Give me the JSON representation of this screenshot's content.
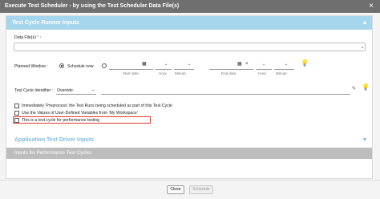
{
  "window": {
    "title": "Execute Test Scheduler - by using the Test Scheduler Data File(s)",
    "close_glyph": "×"
  },
  "runner_section": {
    "title": "Test Cycle Runner Inputs"
  },
  "data_files": {
    "label": "Data File(s)",
    "required_mark": "*",
    "value": ""
  },
  "planned_window": {
    "label": "Planned Window :",
    "schedule_now_label": "Schedule now",
    "start_date_label": "Start date",
    "start_hour_label": "Hour",
    "start_minute_label": "Minute",
    "end_date_label": "End date",
    "end_hour_label": "Hour",
    "end_minute_label": "Minute"
  },
  "identifier": {
    "label": "Test Cycle Identifier :",
    "mode_value": "Override",
    "value": ""
  },
  "options": [
    {
      "label": "Immediately 'Preprocess' the Test Runs being scheduled as part of this Test Cycle",
      "checked": false
    },
    {
      "label": "Use the Values of User-Defined Variables from 'My Workspace'",
      "checked": false
    },
    {
      "label": "This is a test cycle for performance testing",
      "checked": false
    }
  ],
  "driver_section": {
    "title": "Application Test Driver Inputs"
  },
  "perf_section": {
    "title": "Inputs for Performance Test Cycles"
  },
  "buttons": {
    "close": "Close",
    "schedule": "Schedule"
  },
  "colors": {
    "section_header": "#a6d5ee",
    "title_bar": "#6f6f6f",
    "highlight_border": "#e53935"
  }
}
